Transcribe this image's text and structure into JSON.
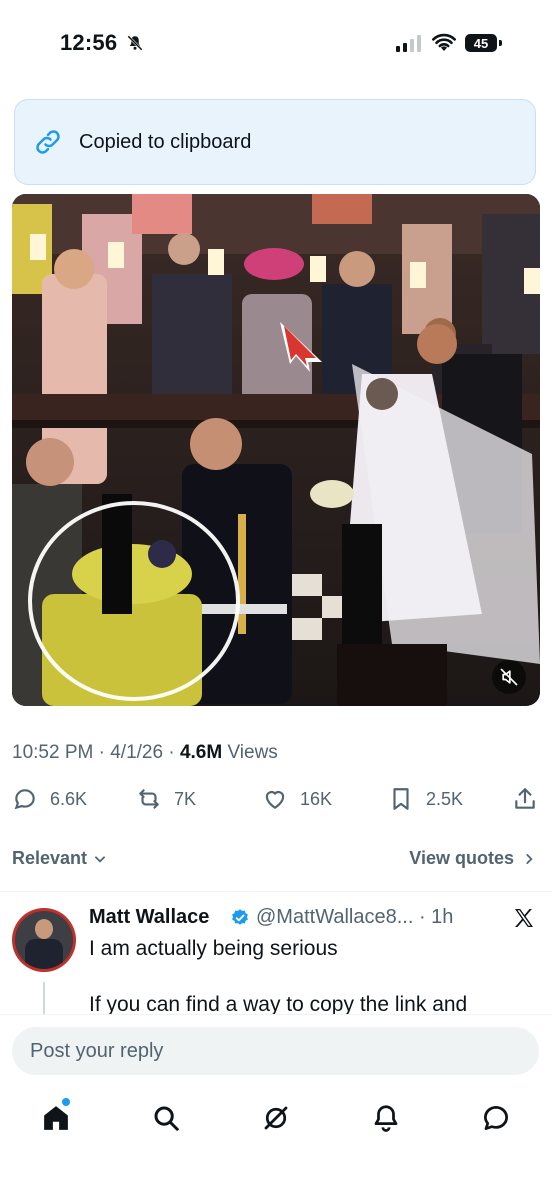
{
  "status_bar": {
    "time": "12:56",
    "battery": "45",
    "icons": [
      "bell-slash-icon",
      "signal-icon",
      "wifi-icon",
      "battery-icon"
    ]
  },
  "toast": {
    "text": "Copied to clipboard",
    "icon": "link-icon"
  },
  "media": {
    "type": "video",
    "mute_icon": "muted-speaker-icon"
  },
  "post_meta": {
    "time": "10:52 PM",
    "sep1": " · ",
    "date": "4/1/26",
    "sep2": " · ",
    "views_count": "4.6M",
    "views_label": " Views"
  },
  "actions": {
    "replies": "6.6K",
    "reposts": "7K",
    "likes": "16K",
    "bookmarks": "2.5K",
    "icons": [
      "reply-icon",
      "repost-icon",
      "like-icon",
      "bookmark-icon",
      "share-icon"
    ]
  },
  "sort": {
    "label": "Relevant",
    "view_quotes": "View quotes"
  },
  "reply": {
    "name": "Matt Wallace",
    "handle": "@MattWallace8...",
    "separator": " · ",
    "time": "1h",
    "text_line1": "I am actually being serious",
    "text_line2": "If you can find a way to copy the link and"
  },
  "composer": {
    "placeholder": "Post your reply"
  },
  "tab_bar": {
    "items": [
      "home-icon",
      "search-icon",
      "grok-icon",
      "notifications-icon",
      "messages-icon"
    ]
  },
  "colors": {
    "accent": "#1d9bf0",
    "secondary_text": "#536471",
    "toast_bg": "#e8f3fc",
    "avatar_ring": "#c0302a"
  }
}
